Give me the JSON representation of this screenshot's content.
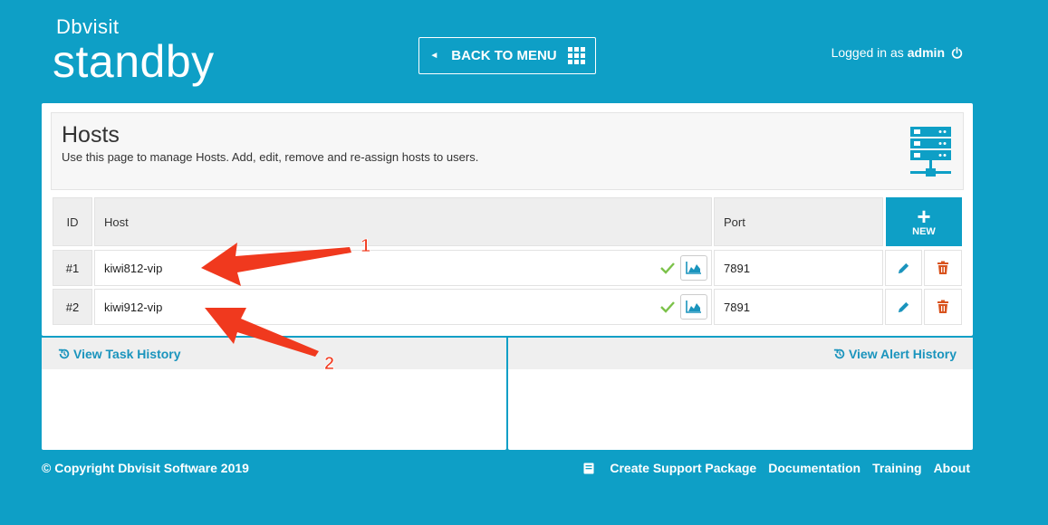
{
  "logo": {
    "brand": "Dbvisit",
    "product": "standby"
  },
  "header": {
    "back_label": "BACK TO MENU",
    "logged_prefix": "Logged in as",
    "user": "admin"
  },
  "page": {
    "title": "Hosts",
    "description": "Use this page to manage Hosts. Add, edit, remove and re-assign hosts to users."
  },
  "table": {
    "columns": {
      "id": "ID",
      "host": "Host",
      "port": "Port"
    },
    "new_label": "NEW",
    "rows": [
      {
        "id": "#1",
        "host": "kiwi812-vip",
        "port": "7891"
      },
      {
        "id": "#2",
        "host": "kiwi912-vip",
        "port": "7891"
      }
    ]
  },
  "history": {
    "task_label": "View Task History",
    "alert_label": "View Alert History"
  },
  "footer": {
    "copyright": "© Copyright Dbvisit Software 2019",
    "links": [
      "Create Support Package",
      "Documentation",
      "Training",
      "About"
    ]
  },
  "annotations": [
    "1",
    "2"
  ],
  "colors": {
    "brand": "#0e9fc6",
    "check": "#7cc24a",
    "delete": "#d9531e",
    "arrow": "#f0391e"
  }
}
